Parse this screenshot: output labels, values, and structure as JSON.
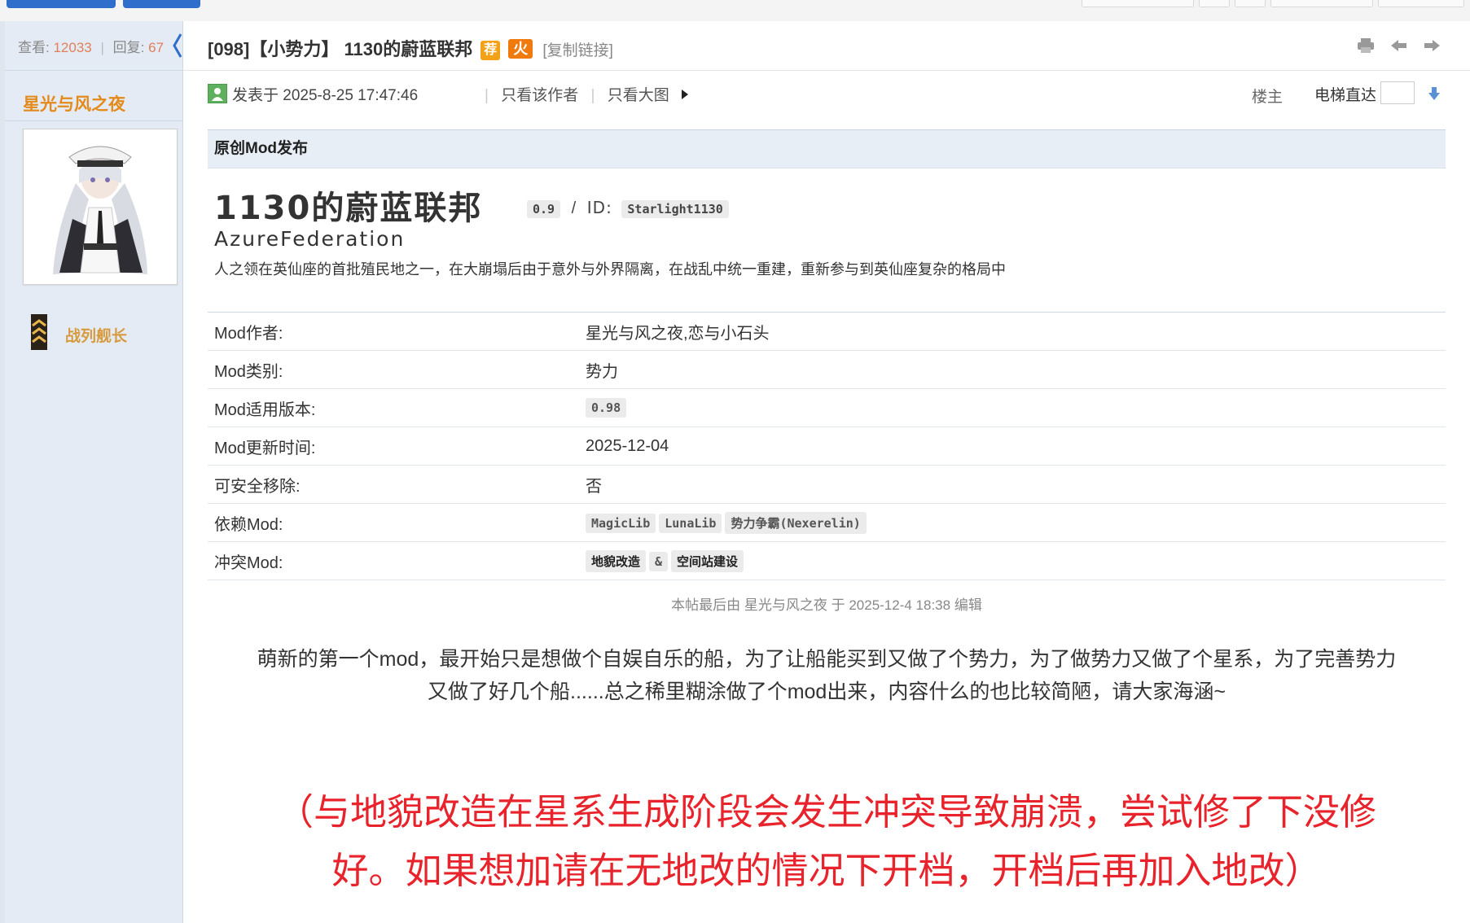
{
  "thread": {
    "views_label": "查看:",
    "views": "12033",
    "replies_label": "回复:",
    "replies": "67",
    "title": "[098]【小势力】 1130的蔚蓝联邦",
    "badge_recommend": "荐",
    "badge_hot": "火",
    "copy_link": "[复制链接]"
  },
  "author": {
    "name": "星光与风之夜",
    "rank": "战列舰长"
  },
  "post": {
    "posted_at": "发表于 2025-8-25 17:47:46",
    "only_author": "只看该作者",
    "only_images": "只看大图",
    "floor": "楼主",
    "elevator": "电梯直达"
  },
  "mod": {
    "category": "原创Mod发布",
    "title": "1130的蔚蓝联邦",
    "version": "0.9",
    "id_label": "ID:",
    "id": "Starlight1130",
    "subtitle": "AzureFederation",
    "description": "人之领在英仙座的首批殖民地之一，在大崩塌后由于意外与外界隔离，在战乱中统一重建，重新参与到英仙座复杂的格局中",
    "rows": {
      "author_key": "Mod作者:",
      "author_val": "星光与风之夜,恋与小石头",
      "type_key": "Mod类别:",
      "type_val": "势力",
      "game_version_key": "Mod适用版本:",
      "game_version_val": "0.98",
      "updated_key": "Mod更新时间:",
      "updated_val": "2025-12-04",
      "removable_key": "可安全移除:",
      "removable_val": "否",
      "deps_key": "依赖Mod:",
      "deps": [
        "MagicLib",
        "LunaLib",
        "势力争霸(Nexerelin)"
      ],
      "conflicts_key": "冲突Mod:",
      "conflict_1": "地貌改造",
      "conflict_sep": "&",
      "conflict_2": "空间站建设"
    }
  },
  "edit_note": "本帖最后由 星光与风之夜 于 2025-12-4 18:38 编辑",
  "body_line1": "萌新的第一个mod，最开始只是想做个自娱自乐的船，为了让船能买到又做了个势力，为了做势力又做了个星系，为了完善势力",
  "body_line2": "又做了好几个船......总之稀里糊涂做了个mod出来，内容什么的也比较简陋，请大家海涵~",
  "warning_line1": "（与地貌改造在星系生成阶段会发生冲突导致崩溃，尝试修了下没修",
  "warning_line2": "好。如果想加请在无地改的情况下开档，开档后再加入地改）",
  "icons": [
    "print-icon",
    "prev-thread-icon",
    "next-thread-icon",
    "user-online-icon",
    "play-icon",
    "down-arrow-icon",
    "rank-insignia-icon",
    "collapse-arrow-icon"
  ],
  "colors": {
    "accent_blue": "#2f6fcb",
    "author_orange": "#e38a1b",
    "rank_gold": "#d79b3f",
    "stat_number": "#e0805a",
    "warning_red": "#e8232b"
  }
}
